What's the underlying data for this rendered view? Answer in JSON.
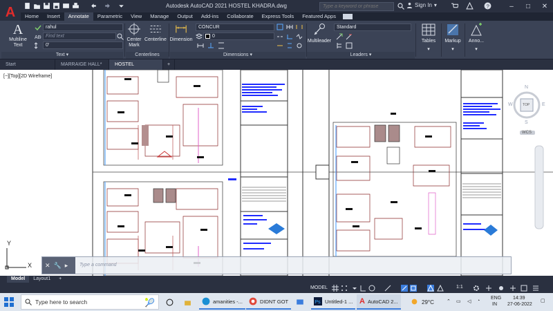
{
  "app": {
    "logo_letter": "A",
    "title": "Autodesk AutoCAD 2021   HOSTEL KHADRA.dwg",
    "search_placeholder": "Type a keyword or phrase",
    "sign_in": "Sign In",
    "accent": "#e02b2b"
  },
  "ribbon_tabs": [
    "Home",
    "Insert",
    "Annotate",
    "Parametric",
    "View",
    "Manage",
    "Output",
    "Add-ins",
    "Collaborate",
    "Express Tools",
    "Featured Apps"
  ],
  "active_ribbon_tab": "Annotate",
  "ribbon": {
    "text_panel": {
      "multiline_text": "Multiline Text",
      "style_value": "rahul",
      "find_placeholder": "Find text",
      "height_value": "0'",
      "label": "Text"
    },
    "centerlines_panel": {
      "center_mark": "Center Mark",
      "centerline": "Centerline",
      "label": "Centerlines"
    },
    "dimensions_panel": {
      "dimension": "Dimension",
      "dimstyle_value": "CONCUR",
      "layer_value": "0",
      "label": "Dimensions"
    },
    "leaders_panel": {
      "multileader": "Multileader",
      "style_value": "Standard",
      "label": "Leaders"
    },
    "tables": "Tables",
    "markup": "Markup",
    "annotation": "Anno..."
  },
  "doc_tabs": [
    "Start",
    "MARRAIGE HALL*",
    "HOSTEL KHADRA*"
  ],
  "active_doc_tab": "HOSTEL KHADRA*",
  "viewport_label": "[−][Top][2D Wireframe]",
  "viewcube": {
    "north": "N",
    "south": "S",
    "east": "E",
    "west": "W",
    "face": "TOP",
    "wcs": "WCS"
  },
  "command_placeholder": "Type a command",
  "layout_tabs": [
    "Model",
    "Layout1"
  ],
  "active_layout_tab": "Model",
  "status": {
    "model": "MODEL",
    "scale": "1:1"
  },
  "taskbar": {
    "search_placeholder": "Type here to search",
    "items": [
      {
        "label": "amanities -..."
      },
      {
        "label": "DIDNT GOT"
      },
      {
        "label": ""
      },
      {
        "label": "Untitled-1 ..."
      },
      {
        "label": "AutoCAD 2..."
      }
    ],
    "weather": "29°C",
    "lang_top": "ENG",
    "lang_bottom": "IN",
    "time": "14:39",
    "date": "27-06-2022"
  }
}
